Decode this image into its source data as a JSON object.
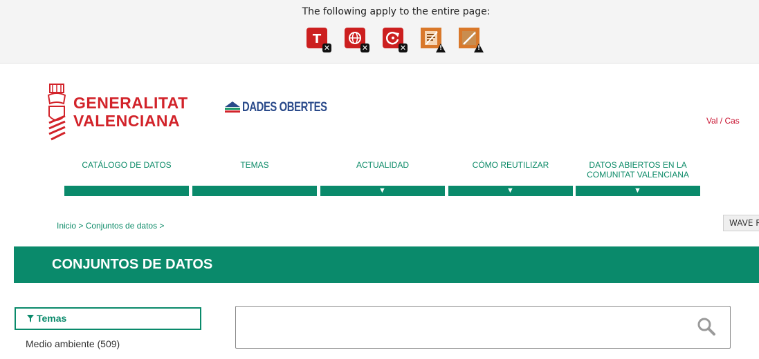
{
  "wave": {
    "title": "The following apply to the entire page:",
    "icons": [
      {
        "name": "error-text-icon",
        "color": "#cc1f1f",
        "badge": "x"
      },
      {
        "name": "error-language-icon",
        "color": "#cc1f1f",
        "badge": "x"
      },
      {
        "name": "error-refresh-icon",
        "color": "#cc1f1f",
        "badge": "x"
      },
      {
        "name": "alert-document-icon",
        "color": "#d9782a",
        "badge": "warn"
      },
      {
        "name": "alert-layout-icon",
        "color": "#d9782a",
        "badge": "warn"
      }
    ],
    "report_label": "WAVE R"
  },
  "header": {
    "logo_gv_line1": "GENERALITAT",
    "logo_gv_line2": "VALENCIANA",
    "logo_do": "DADES OBERTES",
    "lang": "Val / Cas"
  },
  "nav": {
    "items": [
      {
        "label": "CATÁLOGO DE DATOS",
        "dropdown": false
      },
      {
        "label": "TEMAS",
        "dropdown": false
      },
      {
        "label": "ACTUALIDAD",
        "dropdown": true
      },
      {
        "label": "CÓMO REUTILIZAR",
        "dropdown": true
      },
      {
        "label": "DATOS ABIERTOS EN LA COMUNITAT VALENCIANA",
        "dropdown": true
      }
    ],
    "arrow": "▼"
  },
  "breadcrumb": "Inicio > Conjuntos de datos >",
  "banner": {
    "title": "CONJUNTOS DE DATOS"
  },
  "facets": {
    "icon": "filter-icon",
    "label": "Temas",
    "items": [
      {
        "label": "Medio ambiente (509)"
      }
    ]
  },
  "search": {
    "placeholder": "",
    "icon": "search-icon"
  },
  "colors": {
    "accent": "#0a8a6b",
    "brand_red": "#d2232a",
    "error": "#cc1f1f",
    "alert": "#d9782a"
  }
}
